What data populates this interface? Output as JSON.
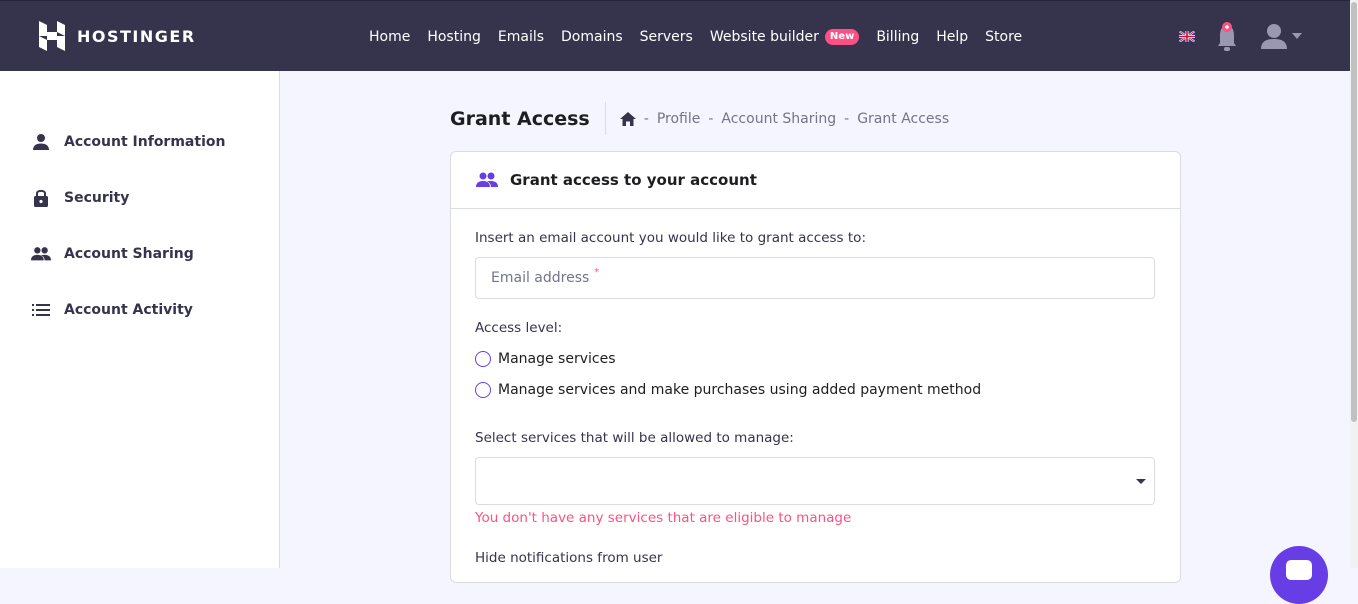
{
  "brand": {
    "name": "HOSTINGER"
  },
  "nav": {
    "items": [
      "Home",
      "Hosting",
      "Emails",
      "Domains",
      "Servers"
    ],
    "website_builder": "Website builder",
    "new_badge": "New",
    "items_after": [
      "Billing",
      "Help",
      "Store"
    ]
  },
  "sidebar": {
    "items": [
      {
        "label": "Account Information",
        "icon": "person-icon"
      },
      {
        "label": "Security",
        "icon": "lock-icon"
      },
      {
        "label": "Account Sharing",
        "icon": "people-icon"
      },
      {
        "label": "Account Activity",
        "icon": "list-icon"
      }
    ]
  },
  "page": {
    "title": "Grant Access",
    "breadcrumb": [
      "Profile",
      "Account Sharing",
      "Grant Access"
    ],
    "breadcrumb_separator": "-"
  },
  "card": {
    "title": "Grant access to your account",
    "email_prompt": "Insert an email account you would like to grant access to:",
    "email_placeholder": "Email address",
    "required_mark": "*",
    "access_level_label": "Access level:",
    "access_options": [
      "Manage services",
      "Manage services and make purchases using added payment method"
    ],
    "services_label": "Select services that will be allowed to manage:",
    "services_value": "",
    "services_error": "You don't have any services that are eligible to manage",
    "hide_notifications_label": "Hide notifications from user"
  },
  "colors": {
    "topbar": "#36344d",
    "accent": "#673de6",
    "error": "#fc5185",
    "badge": "#fc5185"
  }
}
